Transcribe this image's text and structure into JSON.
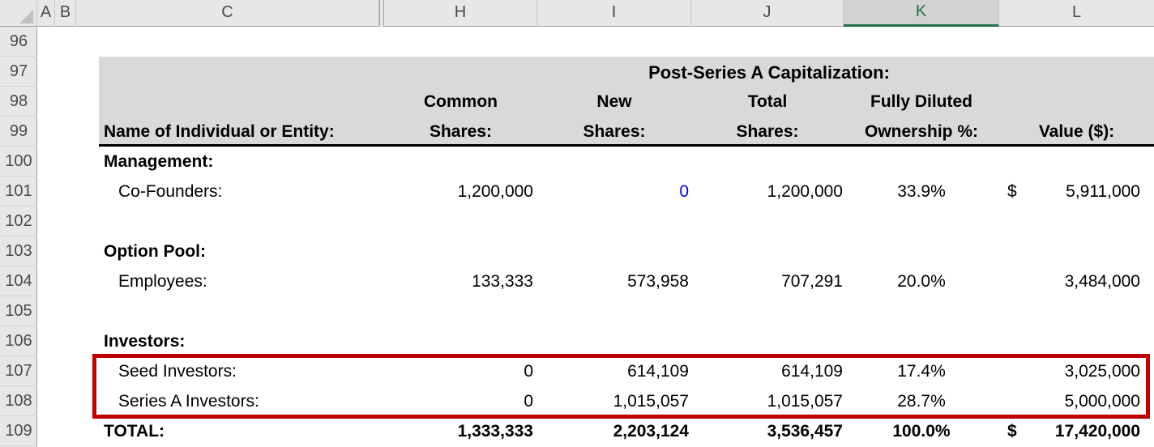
{
  "colors": {
    "accent_green": "#217346",
    "highlight_red": "#c00000",
    "input_blue": "#0000ee",
    "header_fill": "#d9d9d9",
    "chrome_fill": "#e7e7e7",
    "chrome_fill_selected": "#d2d2d2"
  },
  "column_headers": [
    "A",
    "B",
    "C",
    "H",
    "I",
    "J",
    "K",
    "L"
  ],
  "selected_column": "K",
  "row_numbers": [
    "96",
    "97",
    "98",
    "99",
    "100",
    "101",
    "102",
    "103",
    "104",
    "105",
    "106",
    "107",
    "108",
    "109"
  ],
  "table": {
    "title": "Post-Series A Capitalization:",
    "headers": {
      "name": "Name of Individual or Entity:",
      "common_top": "Common",
      "common_bottom": "Shares:",
      "new_top": "New",
      "new_bottom": "Shares:",
      "total_top": "Total",
      "total_bottom": "Shares:",
      "diluted_top": "Fully Diluted",
      "diluted_bottom": "Ownership %:",
      "value": "Value ($):"
    },
    "rows": {
      "r100": {
        "label": "Management:"
      },
      "r101": {
        "label": "Co-Founders:",
        "common": "1,200,000",
        "new_shares": "0",
        "total_shares": "1,200,000",
        "ownership": "33.9%",
        "currency": "$",
        "value": "5,911,000"
      },
      "r103": {
        "label": "Option Pool:"
      },
      "r104": {
        "label": "Employees:",
        "common": "133,333",
        "new_shares": "573,958",
        "total_shares": "707,291",
        "ownership": "20.0%",
        "value": "3,484,000"
      },
      "r106": {
        "label": "Investors:"
      },
      "r107": {
        "label": "Seed Investors:",
        "common": "0",
        "new_shares": "614,109",
        "total_shares": "614,109",
        "ownership": "17.4%",
        "value": "3,025,000"
      },
      "r108": {
        "label": "Series A Investors:",
        "common": "0",
        "new_shares": "1,015,057",
        "total_shares": "1,015,057",
        "ownership": "28.7%",
        "value": "5,000,000"
      },
      "r109": {
        "label": "TOTAL:",
        "common": "1,333,333",
        "new_shares": "2,203,124",
        "total_shares": "3,536,457",
        "ownership": "100.0%",
        "currency": "$",
        "value": "17,420,000"
      }
    }
  }
}
